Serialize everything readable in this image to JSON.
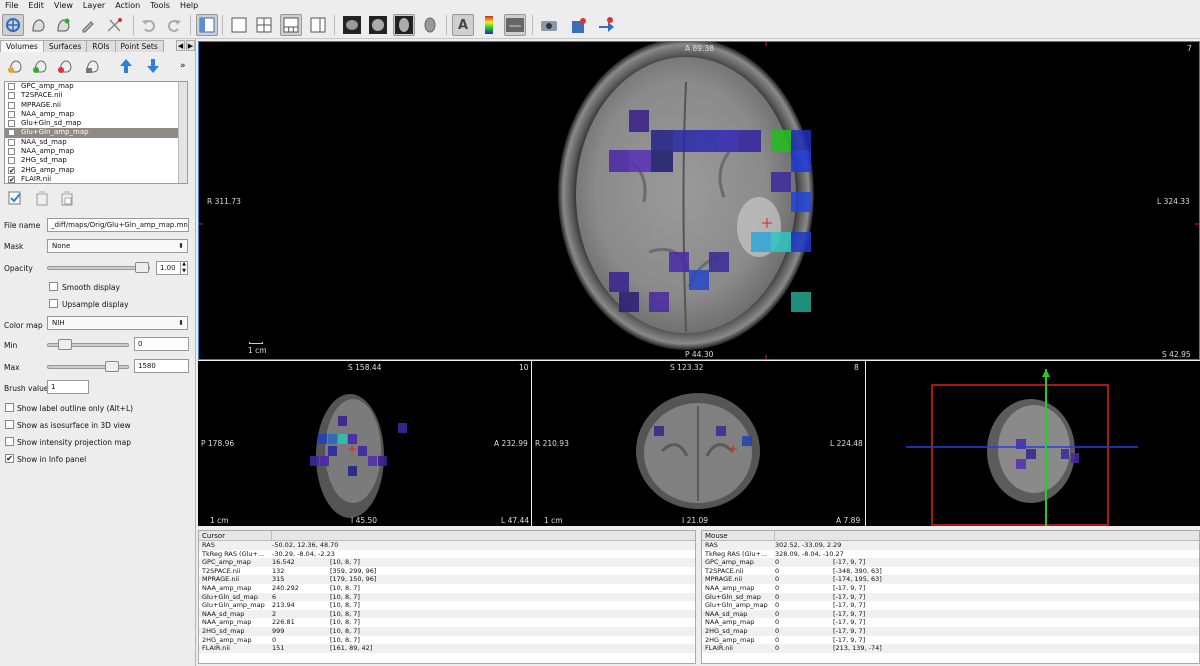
{
  "menu": [
    "File",
    "Edit",
    "View",
    "Layer",
    "Action",
    "Tools",
    "Help"
  ],
  "toolbar": {
    "icons": [
      "navigate-icon",
      "voxel-edit-icon",
      "recon-edit-icon",
      "roi-edit-icon",
      "point-set-edit-icon",
      "undo-icon",
      "redo-icon",
      "layout-1x3-icon",
      "layout-1x1-icon",
      "layout-2x2-icon",
      "layout-1x3-alt-icon",
      "layout-1x3-right-icon",
      "sagittal-view-icon",
      "coronal-view-icon",
      "axial-view-icon",
      "3d-view-icon",
      "text-annotation-icon",
      "colorbar-icon",
      "toggle-info-icon",
      "snapshot-icon",
      "save-point-icon",
      "goto-point-icon"
    ]
  },
  "left": {
    "tabs": [
      "Volumes",
      "Surfaces",
      "ROIs",
      "Point Sets"
    ],
    "tab_arrow_left": "◀",
    "tab_arrow_right": "▶",
    "chevron": "»",
    "layers": [
      {
        "name": "GPC_amp_map",
        "checked": false,
        "selected": false
      },
      {
        "name": "T2SPACE.nii",
        "checked": false,
        "selected": false
      },
      {
        "name": "MPRAGE.nii",
        "checked": false,
        "selected": false
      },
      {
        "name": "NAA_amp_map",
        "checked": false,
        "selected": false
      },
      {
        "name": "Glu+Gln_sd_map",
        "checked": false,
        "selected": false
      },
      {
        "name": "Glu+Gln_amp_map",
        "checked": false,
        "selected": true
      },
      {
        "name": "NAA_sd_map",
        "checked": false,
        "selected": false
      },
      {
        "name": "NAA_amp_map",
        "checked": false,
        "selected": false
      },
      {
        "name": "2HG_sd_map",
        "checked": false,
        "selected": false
      },
      {
        "name": "2HG_amp_map",
        "checked": true,
        "selected": false
      },
      {
        "name": "FLAIR.nii",
        "checked": true,
        "selected": false
      }
    ],
    "file_name_label": "File name",
    "file_name_value": "_diff/maps/Orig/Glu+Gln_amp_map.mnc",
    "mask_label": "Mask",
    "mask_value": "None",
    "opacity_label": "Opacity",
    "opacity_value": "1.00",
    "opacity_level": 1.0,
    "smooth_label": "Smooth display",
    "upsample_label": "Upsample display",
    "colormap_label": "Color map",
    "colormap_value": "NIH",
    "min_label": "Min",
    "min_value": "0",
    "max_label": "Max",
    "max_value": "1580",
    "brush_label": "Brush value",
    "brush_value": "1",
    "opt_outline": "Show label outline only (Alt+L)",
    "opt_isosurface": "Show as isosurface in 3D view",
    "opt_projection": "Show intensity projection map",
    "opt_info": "Show in Info panel",
    "opt_info_checked": true
  },
  "views": {
    "main": {
      "top": "A 89.38",
      "bottom": "P 44.30",
      "left": "R 311.73",
      "right": "L 324.33",
      "num": "7",
      "corner": "S 42.95",
      "scale": "1 cm"
    },
    "sagittal": {
      "top": "S 158.44",
      "bottom": "I 45.50",
      "left": "P 178.96",
      "right": "A 232.99",
      "num": "10",
      "corner": "L 47.44",
      "scale": "1 cm"
    },
    "coronal": {
      "top": "S 123.32",
      "bottom": "I 21.09",
      "left": "R 210.93",
      "right": "L 224.48",
      "num": "8",
      "corner": "A 7.89",
      "scale": "1 cm"
    }
  },
  "info": {
    "cursor_title": "Cursor",
    "mouse_title": "Mouse",
    "cursor_rows": [
      [
        "RAS",
        "-50.02, 12.36, 48.70",
        ""
      ],
      [
        "TkReg RAS (Glu+...",
        "-30.29, -8.04, -2.23",
        ""
      ],
      [
        "GPC_amp_map",
        "16.542",
        "[10, 8, 7]"
      ],
      [
        "T2SPACE.nii",
        "132",
        "[359, 299, 96]"
      ],
      [
        "MPRAGE.nii",
        "315",
        "[179, 150, 96]"
      ],
      [
        "NAA_amp_map",
        "240.292",
        "[10, 8, 7]"
      ],
      [
        "Glu+Gln_sd_map",
        "6",
        "[10, 8, 7]"
      ],
      [
        "Glu+Gln_amp_map",
        "213.94",
        "[10, 8, 7]"
      ],
      [
        "NAA_sd_map",
        "2",
        "[10, 8, 7]"
      ],
      [
        "NAA_amp_map",
        "226.81",
        "[10, 8, 7]"
      ],
      [
        "2HG_sd_map",
        "999",
        "[10, 8, 7]"
      ],
      [
        "2HG_amp_map",
        "0",
        "[10, 8, 7]"
      ],
      [
        "FLAIR.nii",
        "151",
        "[161, 89, 42]"
      ]
    ],
    "mouse_rows": [
      [
        "RAS",
        "302.52, -33.09, 2.29",
        ""
      ],
      [
        "TkReg RAS (Glu+...",
        "328.09, -8.04, -10.27",
        ""
      ],
      [
        "GPC_amp_map",
        "0",
        "[-17, 9, 7]"
      ],
      [
        "T2SPACE.nii",
        "0",
        "[-348, 390, 63]"
      ],
      [
        "MPRAGE.nii",
        "0",
        "[-174, 195, 63]"
      ],
      [
        "NAA_amp_map",
        "0",
        "[-17, 9, 7]"
      ],
      [
        "Glu+Gln_sd_map",
        "0",
        "[-17, 9, 7]"
      ],
      [
        "Glu+Gln_amp_map",
        "0",
        "[-17, 9, 7]"
      ],
      [
        "NAA_sd_map",
        "0",
        "[-17, 9, 7]"
      ],
      [
        "NAA_amp_map",
        "0",
        "[-17, 9, 7]"
      ],
      [
        "2HG_sd_map",
        "0",
        "[-17, 9, 7]"
      ],
      [
        "2HG_amp_map",
        "0",
        "[-17, 9, 7]"
      ],
      [
        "FLAIR.nii",
        "0",
        "[213, 139, -74]"
      ]
    ]
  }
}
